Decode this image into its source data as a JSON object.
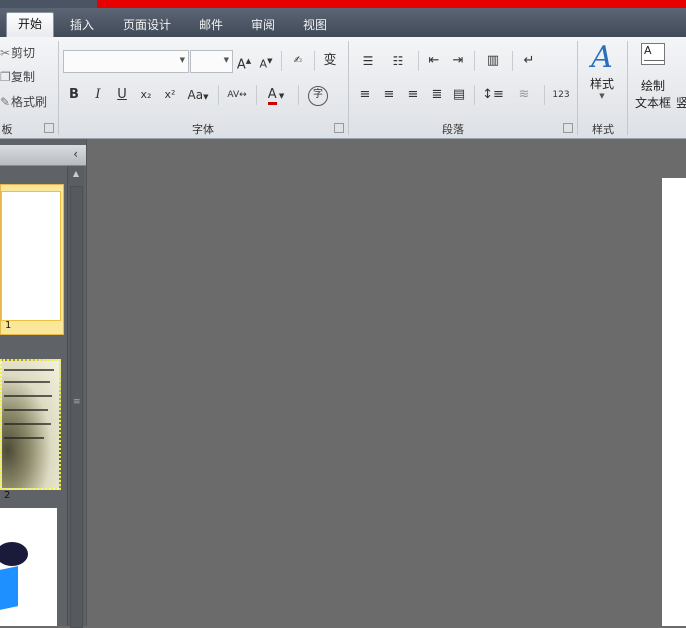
{
  "tabs": [
    {
      "label": "开始",
      "active": true
    },
    {
      "label": "插入",
      "active": false
    },
    {
      "label": "页面设计",
      "active": false
    },
    {
      "label": "邮件",
      "active": false
    },
    {
      "label": "审阅",
      "active": false
    },
    {
      "label": "视图",
      "active": false
    }
  ],
  "clipboard": {
    "cut": "剪切",
    "copy": "复制",
    "format_painter": "格式刷",
    "group_label": "板"
  },
  "font": {
    "font_name": "",
    "font_size": "",
    "bold": "B",
    "italic": "I",
    "underline": "U",
    "subscript": "x₂",
    "superscript": "x²",
    "change_case": "Aa",
    "font_color": "A",
    "grow": "A",
    "shrink": "A",
    "phonetic": "变",
    "enclose": "字",
    "group_label": "字体"
  },
  "paragraph": {
    "group_label": "段落",
    "numbering_label": "123"
  },
  "styles": {
    "label": "样式",
    "group_label": "样式"
  },
  "drawing": {
    "draw_label": "绘制",
    "textbox_label": "文本框",
    "vertical_label": "竖"
  },
  "thumbnails": [
    {
      "number": "1"
    },
    {
      "number": "2"
    }
  ],
  "colors": {
    "accent_red": "#e60000",
    "selected_slot": "#fbe79a",
    "workspace": "#6b6b6b"
  }
}
